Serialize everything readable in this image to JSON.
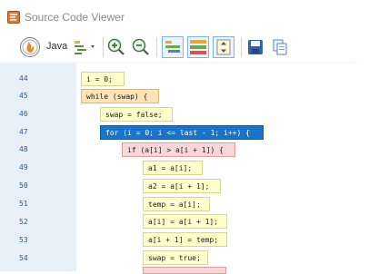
{
  "window": {
    "title": "Source Code Viewer"
  },
  "toolbar": {
    "language_label": "Java",
    "buttons": [
      {
        "name": "language-icon"
      },
      {
        "name": "format-options-icon"
      },
      {
        "name": "zoom-in-icon"
      },
      {
        "name": "zoom-out-icon"
      },
      {
        "name": "layout-list-icon"
      },
      {
        "name": "layout-stack-icon"
      },
      {
        "name": "fit-icon"
      },
      {
        "name": "save-icon"
      },
      {
        "name": "copy-icon"
      }
    ]
  },
  "code": {
    "lines": [
      {
        "num": "44",
        "text": "i = 0;",
        "color": "yellow"
      },
      {
        "num": "45",
        "text": "while (swap) {",
        "color": "orange"
      },
      {
        "num": "46",
        "text": "swap = false;",
        "color": "yellow"
      },
      {
        "num": "47",
        "text": "for (i = 0; i <= last - 1; i++) {",
        "color": "blue"
      },
      {
        "num": "48",
        "text": "if (a[i] > a[i + 1]) {",
        "color": "pink"
      },
      {
        "num": "49",
        "text": "a1 = a[i];",
        "color": "yellow"
      },
      {
        "num": "50",
        "text": "a2 = a[i + 1];",
        "color": "yellow"
      },
      {
        "num": "51",
        "text": "temp = a[i];",
        "color": "yellow"
      },
      {
        "num": "52",
        "text": "a[i] = a[i + 1];",
        "color": "yellow"
      },
      {
        "num": "53",
        "text": "a[i + 1] = temp;",
        "color": "yellow"
      },
      {
        "num": "54",
        "text": "swap = true;",
        "color": "yellow"
      }
    ]
  },
  "colors": {
    "gutter": "#e7eff8",
    "highlight_blue": "#1a73c9",
    "block_yellow": "#ffffcc",
    "block_orange": "#fde3b8",
    "block_pink": "#fbd6d6"
  }
}
